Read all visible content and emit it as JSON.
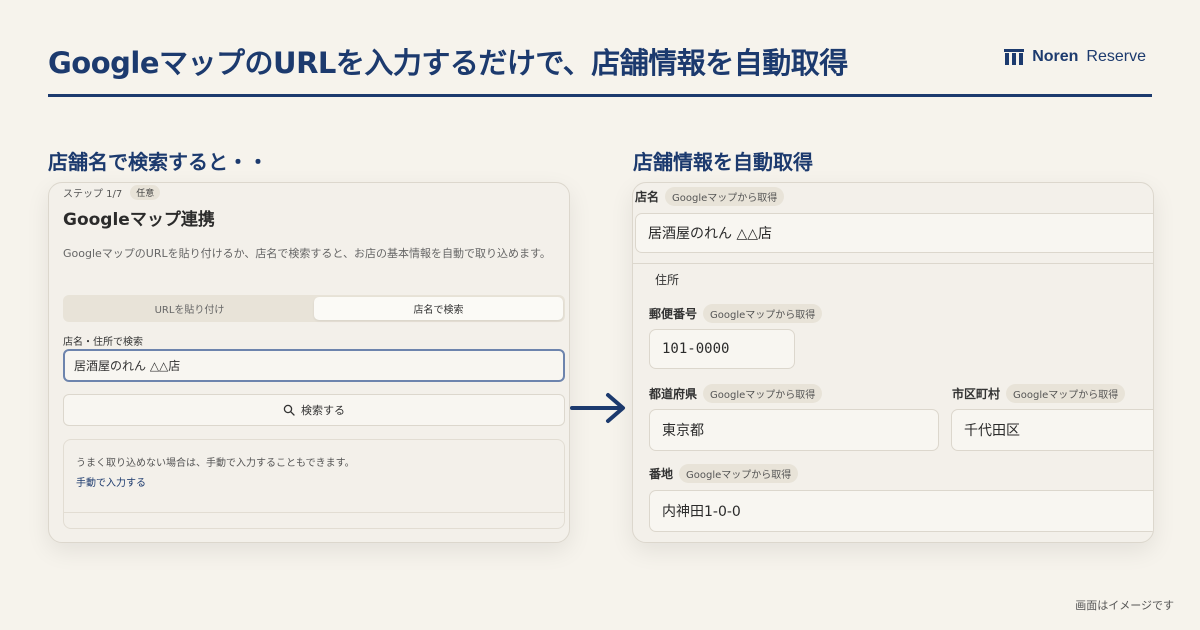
{
  "header": {
    "title": "GoogleマップのURLを入力するだけで、店舗情報を自動取得",
    "brand_bold": "Noren",
    "brand_light": "Reserve"
  },
  "left_section": {
    "title": "店舗名で検索すると・・",
    "step": "ステップ 1/7",
    "step_badge": "任意",
    "card_title": "Googleマップ連携",
    "description": "GoogleマップのURLを貼り付けるか、店名で検索すると、お店の基本情報を自動で取り込めます。",
    "tabs": [
      {
        "label": "URLを貼り付け",
        "active": false
      },
      {
        "label": "店名で検索",
        "active": true
      }
    ],
    "search_label": "店名・住所で検索",
    "search_value": "居酒屋のれん △△店",
    "search_button": "検索する",
    "note_text": "うまく取り込めない場合は、手動で入力することもできます。",
    "note_link": "手動で入力する"
  },
  "right_section": {
    "title": "店舗情報を自動取得",
    "source_badge": "Googleマップから取得",
    "store_name_label": "店名",
    "store_name_value": "居酒屋のれん △△店",
    "address_legend": "住所",
    "postal_label": "郵便番号",
    "postal_value": "101-0000",
    "prefecture_label": "都道府県",
    "prefecture_value": "東京都",
    "city_label": "市区町村",
    "city_value": "千代田区",
    "street_label": "番地",
    "street_value": "内神田1-0-0"
  },
  "footer": {
    "note": "画面はイメージです"
  },
  "colors": {
    "accent": "#1c3a6e",
    "background": "#f6f3ec"
  }
}
